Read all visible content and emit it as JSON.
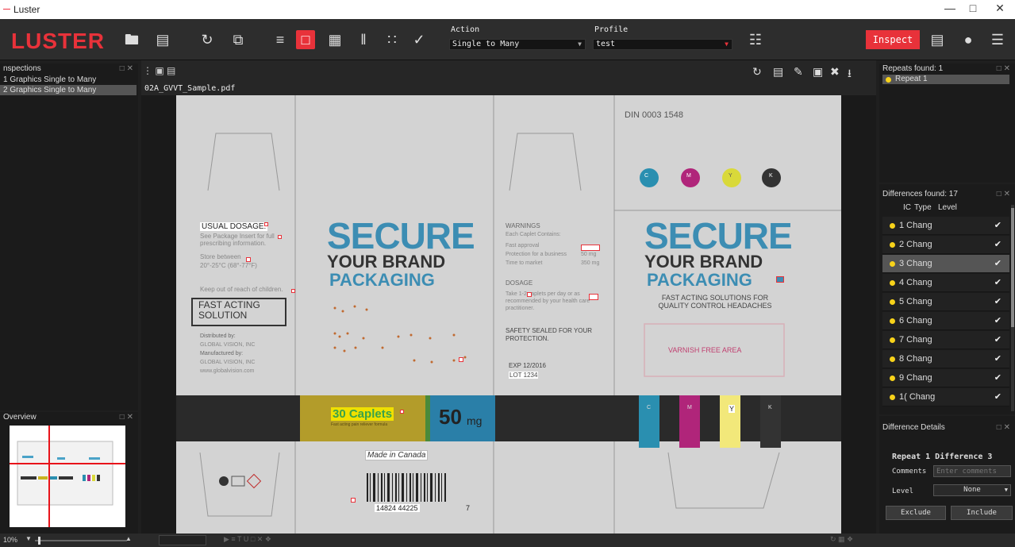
{
  "window": {
    "title": "Luster",
    "logo_mini": "—",
    "min": "—",
    "max": "□",
    "close": "✕"
  },
  "toolbar": {
    "brand": "LUSTER",
    "action_label": "Action",
    "action_value": "Single to Many",
    "profile_label": "Profile",
    "profile_value": "test",
    "inspect_label": "Inspect"
  },
  "inspections": {
    "title": "nspections",
    "items": [
      "1 Graphics Single to Many",
      "2 Graphics Single to Many"
    ],
    "selected_index": 1
  },
  "overview": {
    "title": "Overview"
  },
  "viewer": {
    "filename": "02A_GVVT_Sample.pdf"
  },
  "zoom": {
    "value": "10%"
  },
  "repeats": {
    "title": "Repeats found: 1",
    "items": [
      "Repeat 1"
    ]
  },
  "differences": {
    "title": "Differences found: 17",
    "columns": [
      "IC",
      "Type",
      "Level"
    ],
    "rows": [
      {
        "label": "1 Chang"
      },
      {
        "label": "2 Chang"
      },
      {
        "label": "3 Chang"
      },
      {
        "label": "4 Chang"
      },
      {
        "label": "5 Chang"
      },
      {
        "label": "6 Chang"
      },
      {
        "label": "7 Chang"
      },
      {
        "label": "8 Chang"
      },
      {
        "label": "9 Chang"
      },
      {
        "label": "1( Chang"
      }
    ],
    "selected_index": 2
  },
  "details": {
    "title": "Difference Details",
    "heading": "Repeat 1 Difference 3",
    "comments_label": "Comments",
    "comments_placeholder": "Enter comments",
    "level_label": "Level",
    "level_value": "None",
    "exclude_label": "Exclude",
    "include_label": "Include"
  },
  "artwork": {
    "din": "DIN 0003 1548",
    "cmyk": [
      "C",
      "M",
      "Y",
      "K"
    ],
    "cmyk_colors": [
      "#2a8fb0",
      "#b0257a",
      "#d9d93a",
      "#333333"
    ],
    "usual_dosage": "USUAL DOSAGE:",
    "see_package": "See Package Insert for full prescribing information.",
    "store": "Store between",
    "store_temp": "20°-25°C (68°-77°F)",
    "keep_out": "Keep out of reach of children.",
    "fast_acting": "FAST ACTING SOLUTION",
    "distributed": "Distributed by:",
    "dist_company": "GLOBAL VISION, INC",
    "manufactured": "Manufactured by:",
    "mfg_company": "GLOBAL VISION, INC",
    "website": "www.globalvision.com",
    "secure": "SECURE",
    "your_brand": "YOUR BRAND",
    "packaging": "PACKAGING",
    "warnings": "WARNINGS",
    "each_caplet": "Each Caplet Contains:",
    "fast_approval": "Fast approval",
    "protection": "Protection for a business",
    "time_to_market": "Time to market",
    "mg_50": "50 mg",
    "mg_350": "350 mg",
    "dosage": "DOSAGE",
    "dosage_text": "Take 1-2 caplets per day or as recommended by your health care practitioner.",
    "safety": "SAFETY SEALED FOR YOUR PROTECTION.",
    "exp": "EXP 12/2016",
    "lot": "LOT 1234",
    "fast_solutions": "FAST ACTING SOLUTIONS FOR QUALITY CONTROL HEADACHES",
    "varnish": "VARNISH FREE AREA",
    "caplets": "30 Caplets",
    "caplets_sub": "Fast acting pain reliever formula",
    "mg_big": "50",
    "mg_unit": "mg",
    "made_in": "Made in Canada",
    "barcode_num": "14824    44225",
    "barcode_tail": "7",
    "bar_y": "Y",
    "bar_c": "C",
    "bar_m": "M",
    "bar_k": "K"
  }
}
